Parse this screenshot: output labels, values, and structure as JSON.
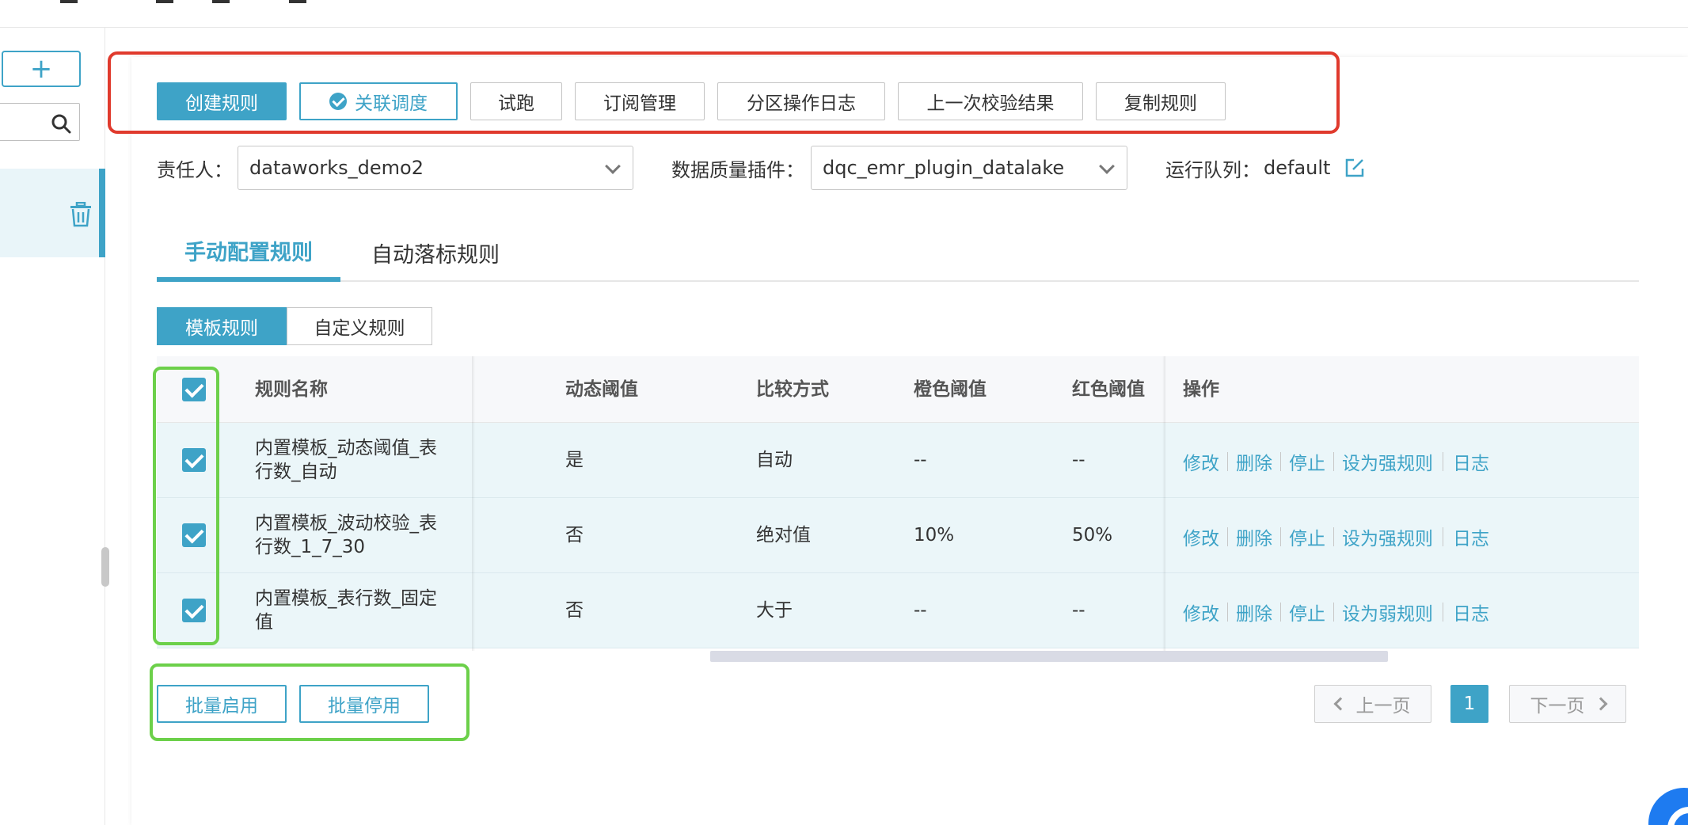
{
  "toolbar": {
    "create_rule": "创建规则",
    "link_schedule": "关联调度",
    "trial_run": "试跑",
    "subscription": "订阅管理",
    "partition_log": "分区操作日志",
    "last_result": "上一次校验结果",
    "copy_rule": "复制规则"
  },
  "owner": {
    "label": "责任人：",
    "value": "dataworks_demo2"
  },
  "plugin": {
    "label": "数据质量插件：",
    "value": "dqc_emr_plugin_datalake"
  },
  "queue": {
    "label": "运行队列：",
    "value": "default"
  },
  "tabs": {
    "manual": "手动配置规则",
    "auto": "自动落标规则"
  },
  "segments": {
    "template": "模板规则",
    "custom": "自定义规则"
  },
  "table": {
    "headers": {
      "name": "规则名称",
      "dynamic": "动态阈值",
      "compare": "比较方式",
      "orange": "橙色阈值",
      "red": "红色阈值",
      "ops": "操作"
    },
    "rows": [
      {
        "name1": "内置模板_动态阈值_表",
        "name2": "行数_自动",
        "dynamic": "是",
        "compare": "自动",
        "orange": "--",
        "red": "--",
        "op_edit": "修改",
        "op_delete": "删除",
        "op_stop": "停止",
        "op_strength": "设为强规则",
        "op_log": "日志"
      },
      {
        "name1": "内置模板_波动校验_表",
        "name2": "行数_1_7_30",
        "dynamic": "否",
        "compare": "绝对值",
        "orange": "10%",
        "red": "50%",
        "op_edit": "修改",
        "op_delete": "删除",
        "op_stop": "停止",
        "op_strength": "设为强规则",
        "op_log": "日志"
      },
      {
        "name1": "内置模板_表行数_固定",
        "name2": "值",
        "dynamic": "否",
        "compare": "大于",
        "orange": "--",
        "red": "--",
        "op_edit": "修改",
        "op_delete": "删除",
        "op_stop": "停止",
        "op_strength": "设为弱规则",
        "op_log": "日志"
      }
    ]
  },
  "batch": {
    "enable": "批量启用",
    "disable": "批量停用"
  },
  "pager": {
    "prev": "上一页",
    "current": "1",
    "next": "下一页"
  },
  "colors": {
    "accent": "#3ea3c7",
    "annotation_red": "#e03a2d",
    "annotation_green": "#6cd04a"
  }
}
